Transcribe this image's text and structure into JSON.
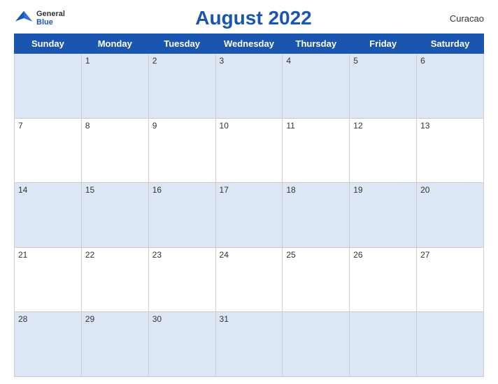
{
  "header": {
    "title": "August 2022",
    "region": "Curacao",
    "logo": {
      "general": "General",
      "blue": "Blue"
    }
  },
  "days_of_week": [
    "Sunday",
    "Monday",
    "Tuesday",
    "Wednesday",
    "Thursday",
    "Friday",
    "Saturday"
  ],
  "weeks": [
    [
      null,
      1,
      2,
      3,
      4,
      5,
      6
    ],
    [
      7,
      8,
      9,
      10,
      11,
      12,
      13
    ],
    [
      14,
      15,
      16,
      17,
      18,
      19,
      20
    ],
    [
      21,
      22,
      23,
      24,
      25,
      26,
      27
    ],
    [
      28,
      29,
      30,
      31,
      null,
      null,
      null
    ]
  ]
}
